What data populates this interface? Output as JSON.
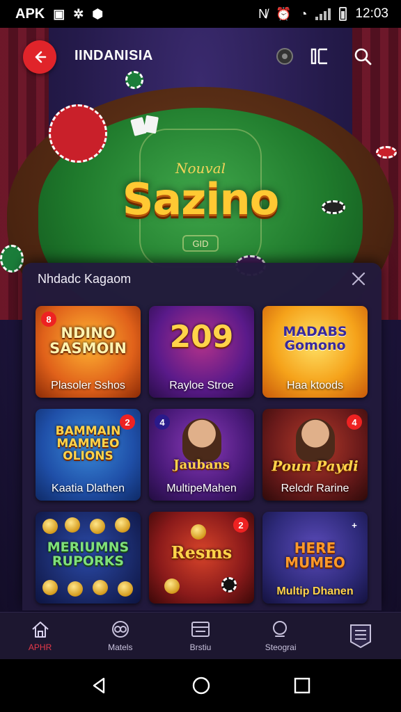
{
  "status_bar": {
    "carrier_label": "APK",
    "time": "12:03",
    "icons": [
      "screenshot-icon",
      "bug-icon",
      "vpn-icon",
      "nfc-icon",
      "alarm-icon",
      "wifi-icon",
      "signal-icon",
      "battery-icon"
    ]
  },
  "header": {
    "title": "IINDANISIA",
    "icons": [
      "back-arrow-icon",
      "chip-icon",
      "layout-icon",
      "search-icon"
    ]
  },
  "hero": {
    "subtitle": "Nouval",
    "title": "Sazino",
    "felt_text": "GID"
  },
  "modal": {
    "title": "Nhdadc Kagaom",
    "close_icon": "close-icon",
    "games": [
      {
        "name": "Plasoler Sshos",
        "logo": "NDINO SASMOIN",
        "badge": "8",
        "theme": "orange"
      },
      {
        "name": "Rayloe Stroe",
        "logo": "209",
        "badge": "",
        "theme": "purple"
      },
      {
        "name": "Haa ktoods",
        "logo": "MADABS Gomono",
        "badge": "",
        "theme": "gold"
      },
      {
        "name": "Kaatia Dlathen",
        "logo": "BAMMAIN MAMMEO OLIONS",
        "badge": "2",
        "theme": "blue"
      },
      {
        "name": "MultipeMahen",
        "logo": "Jaubans",
        "badge": "4",
        "theme": "violet"
      },
      {
        "name": "Relcdr Rarine",
        "logo": "Poun Paydi",
        "badge": "4",
        "theme": "maroon"
      },
      {
        "name": "",
        "logo": "MERIUMNS RUPORKS",
        "badge": "",
        "theme": "navy"
      },
      {
        "name": "",
        "logo": "Resms",
        "badge": "2",
        "theme": "red"
      },
      {
        "name": "Multip Dhanen",
        "logo": "HERE MUMEO",
        "badge": "+",
        "theme": "indigo"
      }
    ]
  },
  "bottom_nav": {
    "items": [
      {
        "label": "APHR",
        "icon": "home-icon",
        "active": true
      },
      {
        "label": "Matels",
        "icon": "games-icon",
        "active": false
      },
      {
        "label": "Brstiu",
        "icon": "wallet-icon",
        "active": false
      },
      {
        "label": "Steograi",
        "icon": "search-icon",
        "active": false
      },
      {
        "label": "",
        "icon": "menu-icon",
        "active": false
      }
    ]
  },
  "system_nav": {
    "icons": [
      "back-icon",
      "home-icon",
      "recents-icon"
    ]
  },
  "colors": {
    "accent": "#e0242a",
    "modal_bg": "#221a3c",
    "felt": "#1f7a2c",
    "gold": "#ffc933"
  }
}
